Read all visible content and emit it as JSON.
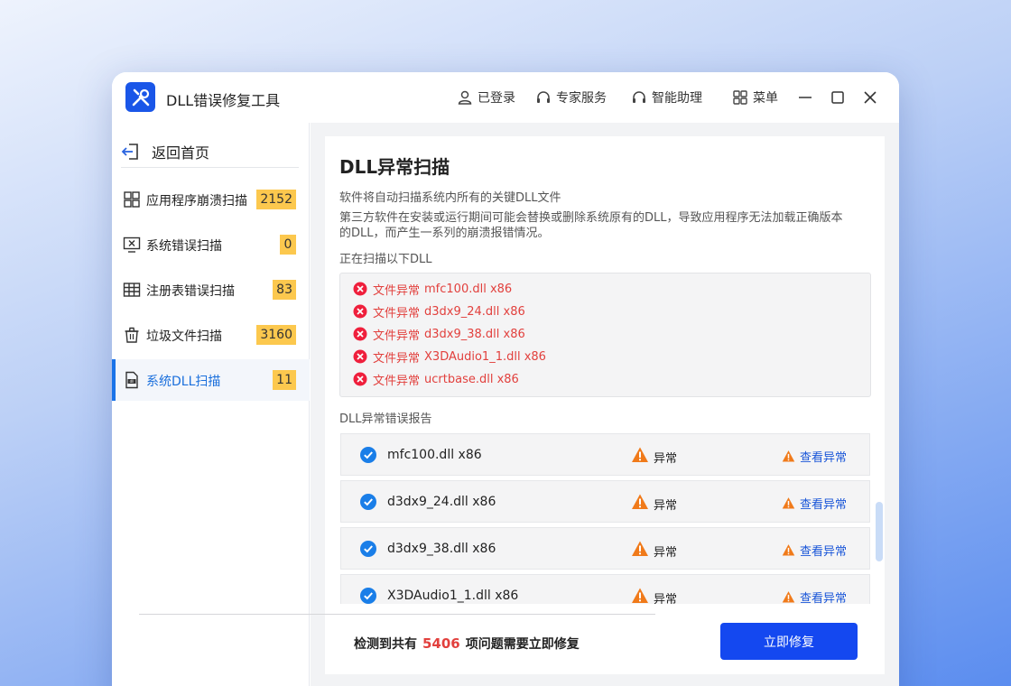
{
  "app": {
    "title": "DLL错误修复工具"
  },
  "titlebar": {
    "login": "已登录",
    "expert": "专家服务",
    "assistant": "智能助理",
    "menu": "菜单"
  },
  "sidebar": {
    "back_home": "返回首页",
    "items": [
      {
        "label": "应用程序崩溃扫描",
        "count": "2152",
        "icon": "grid-apps-icon"
      },
      {
        "label": "系统错误扫描",
        "count": "0",
        "icon": "monitor-error-icon"
      },
      {
        "label": "注册表错误扫描",
        "count": "83",
        "icon": "table-icon"
      },
      {
        "label": "垃圾文件扫描",
        "count": "3160",
        "icon": "trash-icon"
      },
      {
        "label": "系统DLL扫描",
        "count": "11",
        "icon": "dll-file-icon",
        "active": true
      }
    ]
  },
  "main": {
    "title": "DLL异常扫描",
    "desc1": "软件将自动扫描系统内所有的关键DLL文件",
    "desc2": "第三方软件在安装或运行期间可能会替换或删除系统原有的DLL，导致应用程序无法加载正确版本的DLL，而产生一系列的崩溃报错情况。",
    "scanning_label": "正在扫描以下DLL",
    "scan_items": [
      {
        "status": "文件异常",
        "file": "mfc100.dll x86"
      },
      {
        "status": "文件异常",
        "file": "d3dx9_24.dll x86"
      },
      {
        "status": "文件异常",
        "file": "d3dx9_38.dll x86"
      },
      {
        "status": "文件异常",
        "file": "X3DAudio1_1.dll x86"
      },
      {
        "status": "文件异常",
        "file": "ucrtbase.dll x86"
      }
    ],
    "report_label": "DLL异常错误报告",
    "report_rows": [
      {
        "file": "mfc100.dll x86",
        "status": "异常",
        "action": "查看异常"
      },
      {
        "file": "d3dx9_24.dll x86",
        "status": "异常",
        "action": "查看异常"
      },
      {
        "file": "d3dx9_38.dll x86",
        "status": "异常",
        "action": "查看异常"
      },
      {
        "file": "X3DAudio1_1.dll x86",
        "status": "异常",
        "action": "查看异常"
      }
    ],
    "summary_prefix": "检测到共有",
    "summary_count": "5406",
    "summary_suffix": "项问题需要立即修复",
    "fix_button": "立即修复"
  },
  "colors": {
    "accent": "#1448f0",
    "badge": "#fcc84e",
    "error": "#e2403d",
    "warning": "#f07a1a",
    "link": "#1a56d8"
  }
}
